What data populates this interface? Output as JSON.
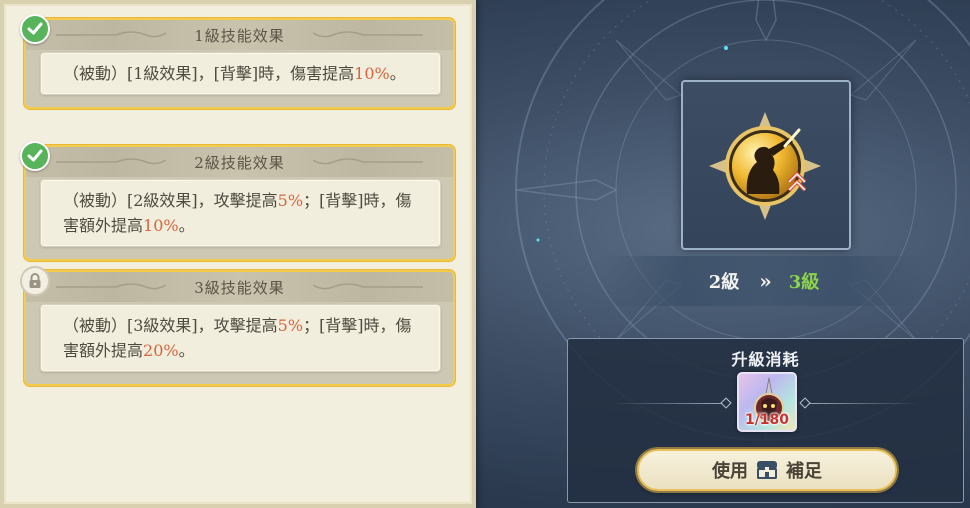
{
  "skill_effects": [
    {
      "title": "1級技能效果",
      "status": "unlocked",
      "status_icon": "check-icon",
      "text_parts": [
        "（被動）[1級效果]，[背擊]時，傷害提高",
        "10%",
        "。"
      ]
    },
    {
      "title": "2級技能效果",
      "status": "unlocked",
      "status_icon": "check-icon",
      "text_parts": [
        "（被動）[2級效果]，攻擊提高",
        "5%",
        "；[背擊]時，傷害額外提高",
        "10%",
        "。"
      ]
    },
    {
      "title": "3級技能效果",
      "status": "locked",
      "status_icon": "lock-icon",
      "text_parts": [
        "（被動）[3級效果]，攻擊提高",
        "5%",
        "；[背擊]時，傷害額外提高",
        "20%",
        "。"
      ]
    }
  ],
  "level": {
    "from": "2級",
    "arrow": "»",
    "to": "3級"
  },
  "upgrade_cost": {
    "title": "升級消耗",
    "item_icon": "skill-book-icon",
    "item_count": "1/180"
  },
  "use_button": {
    "label_before": "使用",
    "icon": "treasure-chest-icon",
    "label_after": "補足"
  },
  "colors": {
    "highlight": "#d8643e",
    "level_to": "#8bd34c",
    "card_border": "#f3cc4d",
    "check_badge": "#58b45a"
  }
}
